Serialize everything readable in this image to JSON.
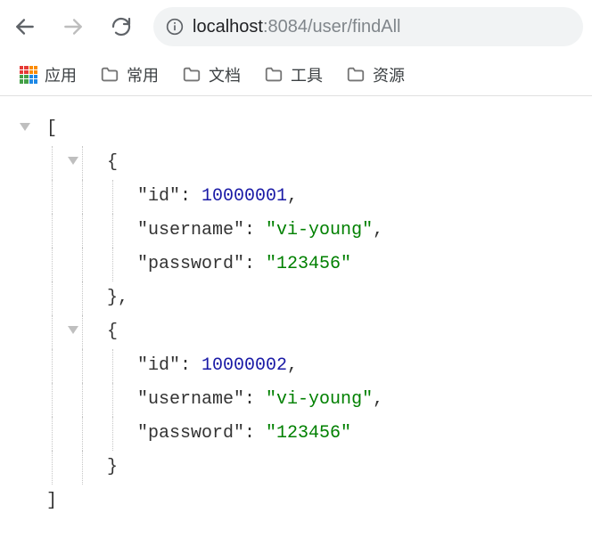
{
  "toolbar": {
    "back_enabled": true,
    "forward_enabled": false,
    "address": {
      "host": "localhost",
      "rest": ":8084/user/findAll"
    }
  },
  "bookmarks": {
    "apps_label": "应用",
    "items": [
      {
        "label": "常用"
      },
      {
        "label": "文档"
      },
      {
        "label": "工具"
      },
      {
        "label": "资源"
      }
    ]
  },
  "json": {
    "open_bracket": "[",
    "close_bracket": "]",
    "open_brace": "{",
    "close_brace_comma": "},",
    "close_brace": "}",
    "entries": [
      {
        "id_key": "\"id\"",
        "id_val": "10000001",
        "id_trail": ",",
        "user_key": "\"username\"",
        "user_val": "\"vi-young\"",
        "user_trail": ",",
        "pass_key": "\"password\"",
        "pass_val": "\"123456\""
      },
      {
        "id_key": "\"id\"",
        "id_val": "10000002",
        "id_trail": ",",
        "user_key": "\"username\"",
        "user_val": "\"vi-young\"",
        "user_trail": ",",
        "pass_key": "\"password\"",
        "pass_val": "\"123456\""
      }
    ]
  }
}
